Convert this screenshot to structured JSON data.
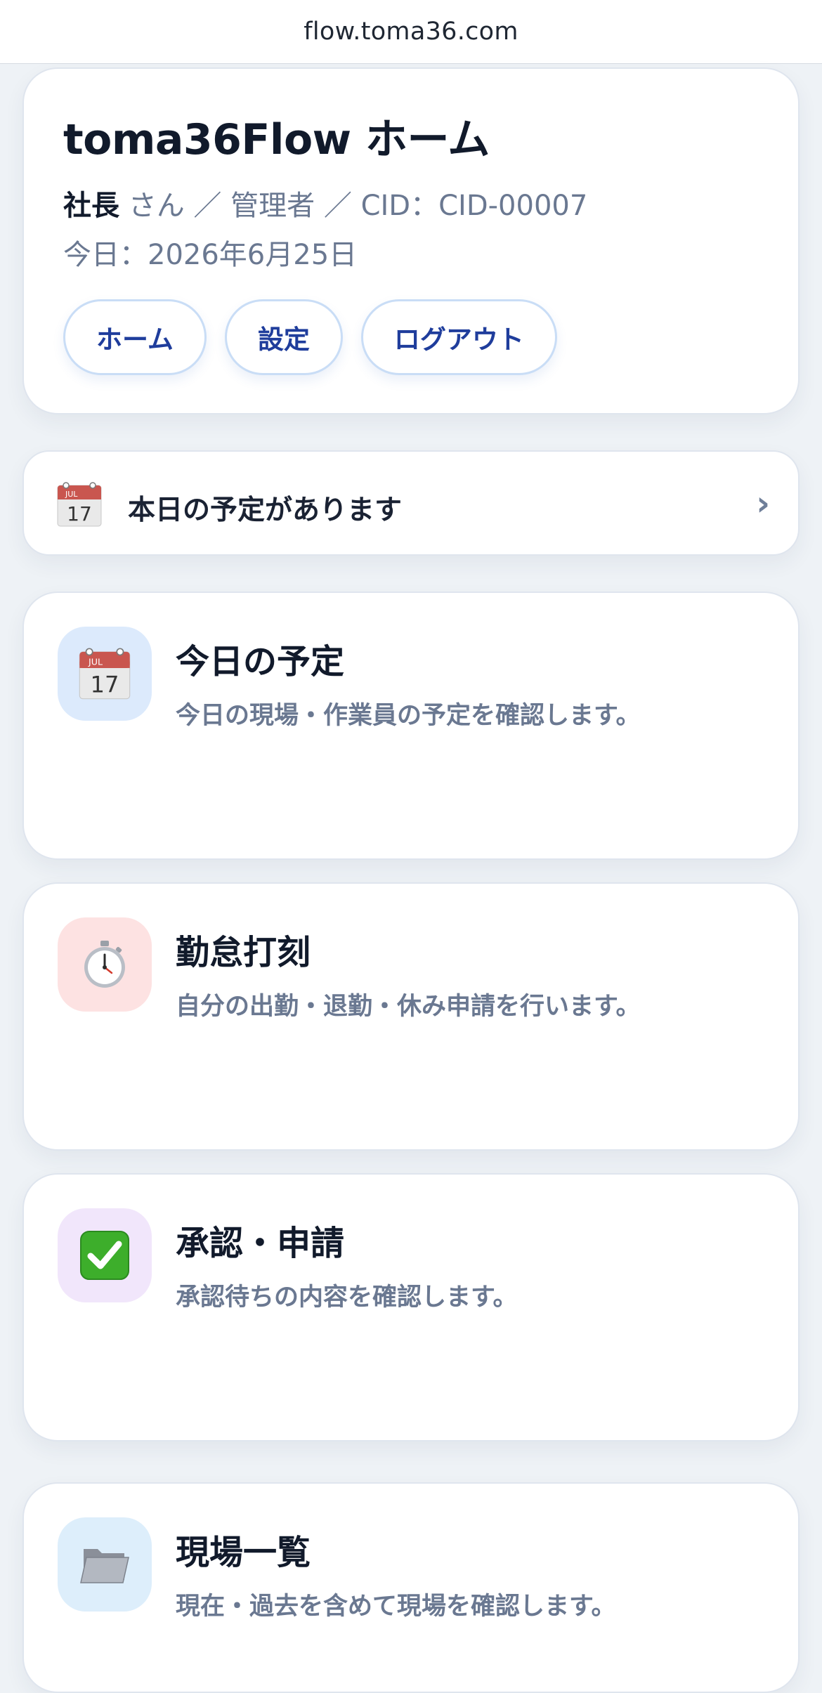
{
  "browser": {
    "url": "flow.toma36.com"
  },
  "header": {
    "title": "toma36Flow ホーム",
    "user_name": "社長",
    "user_rest": " さん ／ 管理者 ／ CID：CID-00007",
    "date": "今日：2026年6月25日",
    "nav": {
      "home_label": "ホーム",
      "settings_label": "設定",
      "logout_label": "ログアウト"
    }
  },
  "notice": {
    "icon": "calendar-icon",
    "text": "本日の予定があります",
    "chevron": "›"
  },
  "features": [
    {
      "title": "今日の予定",
      "description": "今日の現場・作業員の予定を確認します。",
      "icon": "calendar-icon",
      "icon_bg": "#dceafc"
    },
    {
      "title": "勤怠打刻",
      "description": "自分の出勤・退勤・休み申請を行います。",
      "icon": "stopwatch-icon",
      "icon_bg": "#fde2e2"
    },
    {
      "title": "承認・申請",
      "description": "承認待ちの内容を確認します。",
      "icon": "check-mark-icon",
      "icon_bg": "#f1e6fb"
    },
    {
      "title": "現場一覧",
      "description": "現在・過去を含めて現場を確認します。",
      "icon": "folder-icon",
      "icon_bg": "#ddeefb"
    }
  ],
  "colors": {
    "accent": "#1f3d9c",
    "title_text": "#111a2b",
    "muted_text": "#6a7891",
    "background": "#eef2f6"
  }
}
